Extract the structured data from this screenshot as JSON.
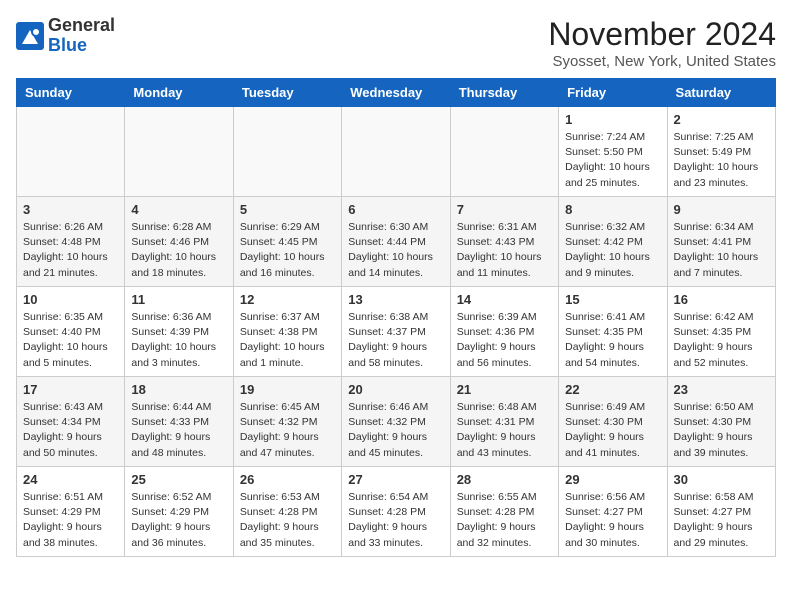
{
  "header": {
    "logo_general": "General",
    "logo_blue": "Blue",
    "month_title": "November 2024",
    "location": "Syosset, New York, United States"
  },
  "weekdays": [
    "Sunday",
    "Monday",
    "Tuesday",
    "Wednesday",
    "Thursday",
    "Friday",
    "Saturday"
  ],
  "weeks": [
    [
      {
        "day": "",
        "info": ""
      },
      {
        "day": "",
        "info": ""
      },
      {
        "day": "",
        "info": ""
      },
      {
        "day": "",
        "info": ""
      },
      {
        "day": "",
        "info": ""
      },
      {
        "day": "1",
        "info": "Sunrise: 7:24 AM\nSunset: 5:50 PM\nDaylight: 10 hours and 25 minutes."
      },
      {
        "day": "2",
        "info": "Sunrise: 7:25 AM\nSunset: 5:49 PM\nDaylight: 10 hours and 23 minutes."
      }
    ],
    [
      {
        "day": "3",
        "info": "Sunrise: 6:26 AM\nSunset: 4:48 PM\nDaylight: 10 hours and 21 minutes."
      },
      {
        "day": "4",
        "info": "Sunrise: 6:28 AM\nSunset: 4:46 PM\nDaylight: 10 hours and 18 minutes."
      },
      {
        "day": "5",
        "info": "Sunrise: 6:29 AM\nSunset: 4:45 PM\nDaylight: 10 hours and 16 minutes."
      },
      {
        "day": "6",
        "info": "Sunrise: 6:30 AM\nSunset: 4:44 PM\nDaylight: 10 hours and 14 minutes."
      },
      {
        "day": "7",
        "info": "Sunrise: 6:31 AM\nSunset: 4:43 PM\nDaylight: 10 hours and 11 minutes."
      },
      {
        "day": "8",
        "info": "Sunrise: 6:32 AM\nSunset: 4:42 PM\nDaylight: 10 hours and 9 minutes."
      },
      {
        "day": "9",
        "info": "Sunrise: 6:34 AM\nSunset: 4:41 PM\nDaylight: 10 hours and 7 minutes."
      }
    ],
    [
      {
        "day": "10",
        "info": "Sunrise: 6:35 AM\nSunset: 4:40 PM\nDaylight: 10 hours and 5 minutes."
      },
      {
        "day": "11",
        "info": "Sunrise: 6:36 AM\nSunset: 4:39 PM\nDaylight: 10 hours and 3 minutes."
      },
      {
        "day": "12",
        "info": "Sunrise: 6:37 AM\nSunset: 4:38 PM\nDaylight: 10 hours and 1 minute."
      },
      {
        "day": "13",
        "info": "Sunrise: 6:38 AM\nSunset: 4:37 PM\nDaylight: 9 hours and 58 minutes."
      },
      {
        "day": "14",
        "info": "Sunrise: 6:39 AM\nSunset: 4:36 PM\nDaylight: 9 hours and 56 minutes."
      },
      {
        "day": "15",
        "info": "Sunrise: 6:41 AM\nSunset: 4:35 PM\nDaylight: 9 hours and 54 minutes."
      },
      {
        "day": "16",
        "info": "Sunrise: 6:42 AM\nSunset: 4:35 PM\nDaylight: 9 hours and 52 minutes."
      }
    ],
    [
      {
        "day": "17",
        "info": "Sunrise: 6:43 AM\nSunset: 4:34 PM\nDaylight: 9 hours and 50 minutes."
      },
      {
        "day": "18",
        "info": "Sunrise: 6:44 AM\nSunset: 4:33 PM\nDaylight: 9 hours and 48 minutes."
      },
      {
        "day": "19",
        "info": "Sunrise: 6:45 AM\nSunset: 4:32 PM\nDaylight: 9 hours and 47 minutes."
      },
      {
        "day": "20",
        "info": "Sunrise: 6:46 AM\nSunset: 4:32 PM\nDaylight: 9 hours and 45 minutes."
      },
      {
        "day": "21",
        "info": "Sunrise: 6:48 AM\nSunset: 4:31 PM\nDaylight: 9 hours and 43 minutes."
      },
      {
        "day": "22",
        "info": "Sunrise: 6:49 AM\nSunset: 4:30 PM\nDaylight: 9 hours and 41 minutes."
      },
      {
        "day": "23",
        "info": "Sunrise: 6:50 AM\nSunset: 4:30 PM\nDaylight: 9 hours and 39 minutes."
      }
    ],
    [
      {
        "day": "24",
        "info": "Sunrise: 6:51 AM\nSunset: 4:29 PM\nDaylight: 9 hours and 38 minutes."
      },
      {
        "day": "25",
        "info": "Sunrise: 6:52 AM\nSunset: 4:29 PM\nDaylight: 9 hours and 36 minutes."
      },
      {
        "day": "26",
        "info": "Sunrise: 6:53 AM\nSunset: 4:28 PM\nDaylight: 9 hours and 35 minutes."
      },
      {
        "day": "27",
        "info": "Sunrise: 6:54 AM\nSunset: 4:28 PM\nDaylight: 9 hours and 33 minutes."
      },
      {
        "day": "28",
        "info": "Sunrise: 6:55 AM\nSunset: 4:28 PM\nDaylight: 9 hours and 32 minutes."
      },
      {
        "day": "29",
        "info": "Sunrise: 6:56 AM\nSunset: 4:27 PM\nDaylight: 9 hours and 30 minutes."
      },
      {
        "day": "30",
        "info": "Sunrise: 6:58 AM\nSunset: 4:27 PM\nDaylight: 9 hours and 29 minutes."
      }
    ]
  ]
}
